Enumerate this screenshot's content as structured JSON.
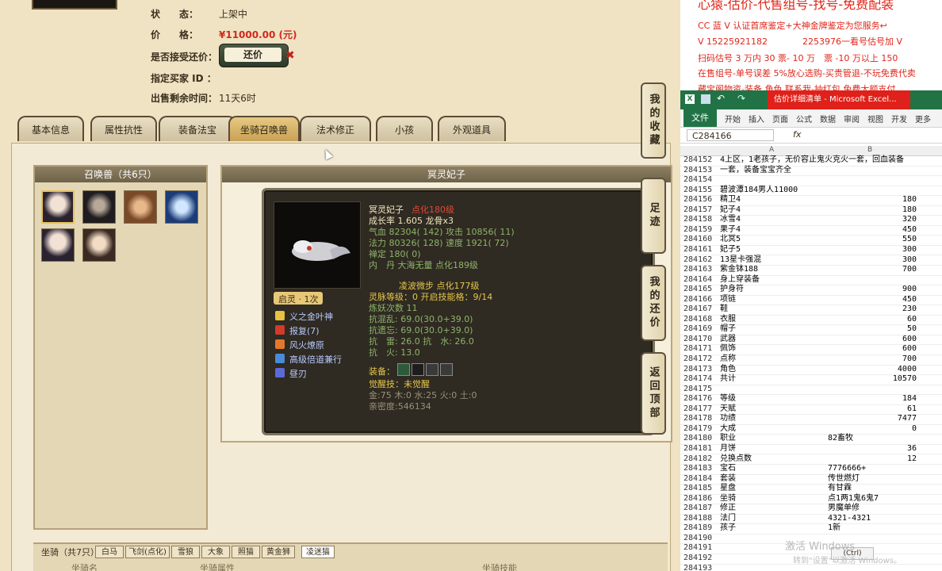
{
  "info": {
    "status_label": "状　　态：",
    "status_value": "上架中",
    "price_label": "价　　格：",
    "price_value": "¥11000.00 (元)",
    "counter_label": "是否接受还价：",
    "counter_button": "还价",
    "counter_x": "✖",
    "buyer_label": "指定买家 ID ：",
    "buyer_value": "",
    "remaining_label": "出售剩余时间：",
    "remaining_value": "11天6时"
  },
  "tabs": [
    "基本信息",
    "属性抗性",
    "装备法宝",
    "坐骑召唤兽",
    "法术修正",
    "小孩",
    "外观道具"
  ],
  "active_tab": "坐骑召唤兽",
  "summon": {
    "title": "召唤兽（共6只）",
    "count": 6
  },
  "detail": {
    "title": "冥灵妃子",
    "name": "冥灵妃子",
    "dianhua": "点化180级",
    "growth": "成长率 1.605 龙骨x3",
    "hp": "气血 82304( 142) 攻击 10856( 11)",
    "mp": "法力 80326( 128) 速度 1921( 72)",
    "spirit": "禅定 180( 0)",
    "neidan": "内　丹 大海无量 点化189级",
    "lingbo": "凌波微步 点化177级",
    "ling_level": "灵脉等级：0 开启技能格：9/14",
    "lianyao": "炼妖次数 11",
    "resist1": "抗混乱: 69.0(30.0+39.0)",
    "resist2": "抗遗忘: 69.0(30.0+39.0)",
    "resist3": "抗　雷: 26.0 抗　水: 26.0",
    "resist4": "抗　火: 13.0",
    "qiling": "启灵 · 1次",
    "skills": [
      "义之金叶神",
      "报复(7)",
      "风火燎原",
      "高级倍道兼行",
      "昼刃"
    ],
    "equip_label": "装备：",
    "awaken": "觉醒技：未觉醒",
    "five_elements": "金:75 木:0 水:25 火:0 土:0",
    "intimacy": "亲密度:546134"
  },
  "mount": {
    "label": "坐骑（共7只）",
    "tabs": [
      "白马",
      "飞剑(点化)",
      "雪狼",
      "大象",
      "照猫",
      "黄金狮",
      "凌迷猫"
    ],
    "cols": [
      "坐骑名",
      "坐骑属性",
      "坐骑技能"
    ]
  },
  "side_nav": [
    "我的收藏",
    "足迹",
    "我的还价",
    "返回顶部"
  ],
  "ads": {
    "title": "心猿-估价-代售组号-找号-免费配装",
    "line1": "CC 蓝 V 认证首席鉴定+大神金牌鉴定为您服务↩",
    "line2": "V 15225921182　　　　2253976一看号估号加 V",
    "line3": "扫码估号 3 万内 30 票- 10 万　票 -10 万以上 150",
    "line4": "在售组号-单号误差 5%放心选购-买贵管退-不玩免费代卖",
    "line5": "藏宝阁物资-装备,角色,联系我-抽红包,免费大额支付"
  },
  "excel": {
    "title": "估价详细清单 - Microsoft Excel...",
    "file_tab": "文件",
    "ribbon": [
      "开始",
      "插入",
      "页面",
      "公式",
      "数据",
      "审阅",
      "视图",
      "开发",
      "更多"
    ],
    "namebox": "C284166",
    "fx": "fx",
    "col_a": "A",
    "col_b": "B",
    "rows": [
      [
        "284152",
        "4上区，1老孩子，无价容止鬼火克火一套，回血装备",
        ""
      ],
      [
        "284153",
        "一套，装备宝宝齐全",
        ""
      ],
      [
        "284154",
        "",
        ""
      ],
      [
        "284155",
        "碧波潭184男人11000",
        ""
      ],
      [
        "284156",
        "精卫4",
        "180"
      ],
      [
        "284157",
        "妃子4",
        "180"
      ],
      [
        "284158",
        "冰雪4",
        "320"
      ],
      [
        "284159",
        "果子4",
        "450"
      ],
      [
        "284160",
        "北冥5",
        "550"
      ],
      [
        "284161",
        "妃子5",
        "300"
      ],
      [
        "284162",
        "13星卡强混",
        "300"
      ],
      [
        "284163",
        "紫金钵188",
        "700"
      ],
      [
        "284164",
        "身上穿装备",
        ""
      ],
      [
        "284165",
        "护身符",
        "900"
      ],
      [
        "284166",
        "项链",
        "450"
      ],
      [
        "284167",
        "鞋",
        "230"
      ],
      [
        "284168",
        "衣服",
        "60"
      ],
      [
        "284169",
        "帽子",
        "50"
      ],
      [
        "284170",
        "武器",
        "600"
      ],
      [
        "284171",
        "佩饰",
        "600"
      ],
      [
        "284172",
        "点称",
        "700"
      ],
      [
        "284173",
        "角色",
        "4000"
      ],
      [
        "284174",
        "共计",
        "10570"
      ],
      [
        "284175",
        "",
        ""
      ],
      [
        "284176",
        "等级",
        "184"
      ],
      [
        "284177",
        "天赋",
        "61"
      ],
      [
        "284178",
        "功绩",
        "7477"
      ],
      [
        "284179",
        "大成",
        "0"
      ],
      [
        "284180",
        "职业",
        "82畜牧"
      ],
      [
        "284181",
        "月饼",
        "36"
      ],
      [
        "284182",
        "兑换点数",
        "12"
      ],
      [
        "284183",
        "宝石",
        "7776666+"
      ],
      [
        "284184",
        "套装",
        "传世燃灯"
      ],
      [
        "284185",
        "星盘",
        "有甘霖"
      ],
      [
        "284186",
        "坐骑",
        "点1两1鬼6鬼7"
      ],
      [
        "284187",
        "修正",
        "男魔单修"
      ],
      [
        "284188",
        "法门",
        "4321-4321"
      ],
      [
        "284189",
        "孩子",
        "1新"
      ],
      [
        "284190",
        "",
        ""
      ],
      [
        "284191",
        "",
        ""
      ],
      [
        "284192",
        "",
        ""
      ],
      [
        "284193",
        "",
        ""
      ]
    ],
    "ctrl": "(Ctrl)",
    "watermark": "激活 Windows",
    "watermark_sub": "转到\"设置\"以激活 Windows。"
  }
}
